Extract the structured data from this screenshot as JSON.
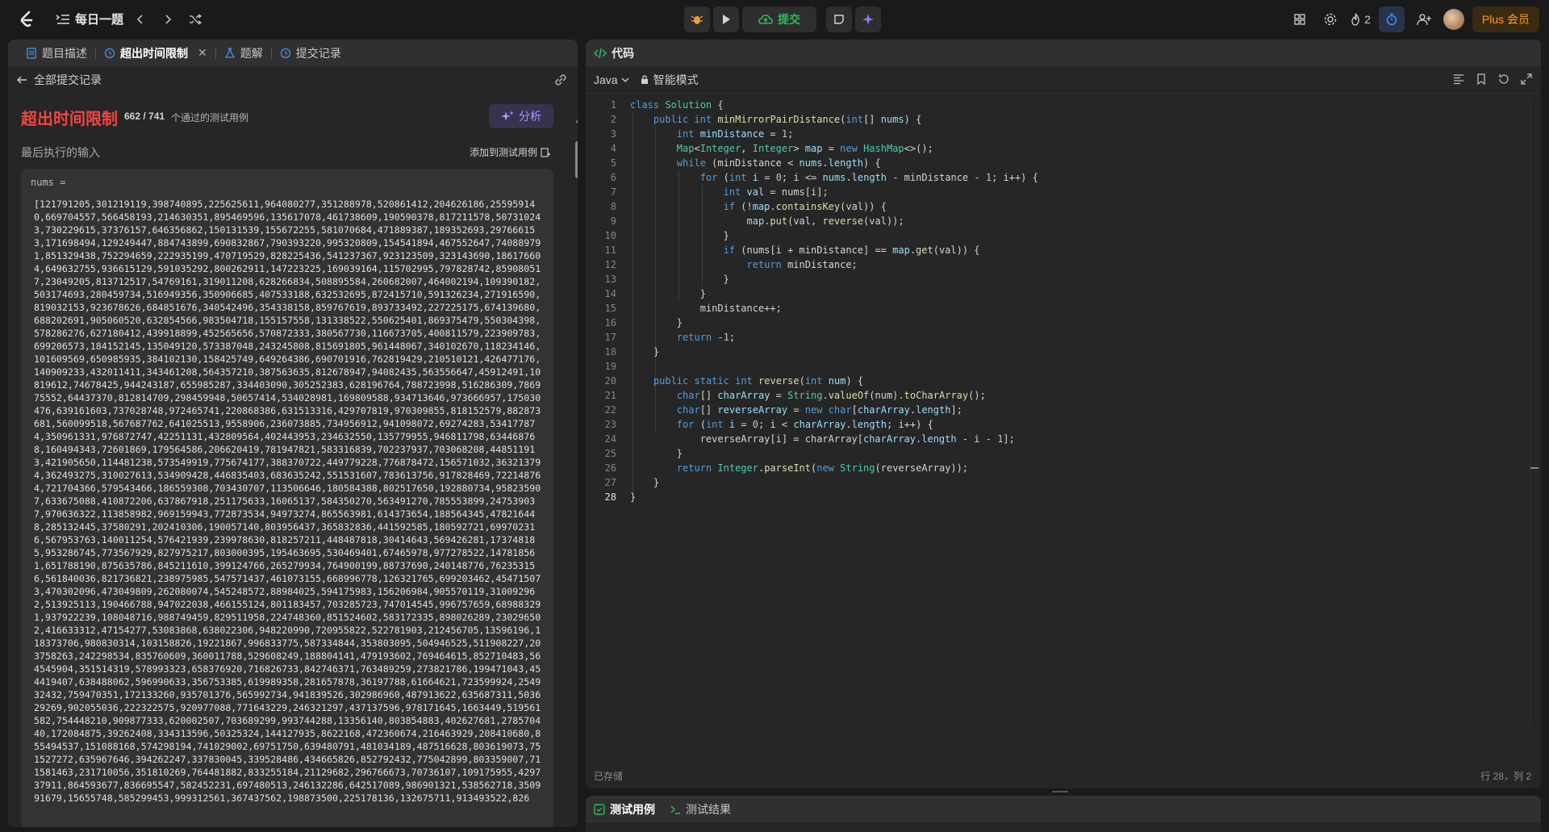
{
  "topbar": {
    "title": "每日一题",
    "submit_label": "提交",
    "streak_count": "2",
    "plus_label": "Plus 会员"
  },
  "left": {
    "tabs": [
      {
        "label": "题目描述"
      },
      {
        "label": "超出时间限制"
      },
      {
        "label": "题解"
      },
      {
        "label": "提交记录"
      }
    ],
    "back_label": "全部提交记录",
    "status": "超出时间限制",
    "count": "662 / 741",
    "count_suffix": "个通过的测试用例",
    "analyze_label": "分析",
    "last_input_label": "最后执行的输入",
    "add_testcase_label": "添加到测试用例",
    "input_key": "nums =",
    "input_value": "[121791205,301219119,398740895,225625611,964080277,351288978,520861412,204626186,255959140,669704557,566458193,214630351,895469596,135617078,461738609,190590378,817211578,507310243,730229615,37376157,646356862,150131539,155672255,581070684,471889387,189352693,297666153,171698494,129249447,884743899,690832867,790393220,995320809,154541894,467552647,740889791,851329438,752294659,222935199,470719529,828225436,541237367,923123509,323143690,186176604,649632755,936615129,591035292,800262911,147223225,169039164,115702995,797828742,859080517,23049205,813712517,54769161,319011208,628266834,508895584,260682007,464002194,109390182,503174693,280459734,516949356,350906685,407533188,632532695,872415710,591326234,271916590,819032153,923678626,684851676,340542496,354338158,859767619,893733492,227225175,674139680,688202691,905060520,632854566,983504718,155157558,131338522,550625401,869375479,550304398,578286276,627180412,439918899,452565656,570872333,380567730,116673705,400811579,223909783,699206573,184152145,135049120,573387048,243245808,815691805,961448067,340102670,118234146,101609569,650985935,384102130,158425749,649264386,690701916,762819429,210510121,426477176,140909233,432011411,343461208,564357210,387563635,812678947,94082435,563556647,45912491,10819612,74678425,944243187,655985287,334403090,305252383,628196764,788723998,516286309,786975552,64437370,812814709,298459948,50657414,534028981,169809588,934713646,973666957,175030476,639161603,737028748,972465741,220868386,631513316,429707819,970309855,818152579,882873681,560099518,567687762,641025513,9558906,236073885,734956912,941098072,69274283,534177874,350961331,976872747,42251131,432809564,402443953,234632550,135779955,946811798,634468768,160494343,72601869,179564586,206620419,781947821,583316839,702237937,703068208,448511913,421905650,114481238,573549919,775674177,388370722,449779228,776878472,156571032,363213794,362493275,310027613,534909428,446835403,683635242,551531607,783613756,917828469,722148764,721704366,579543466,186559308,703430707,113506646,180584388,802517650,192880734,958235907,633675088,410872206,637867918,251175633,16065137,584350270,563491270,785553899,247539037,970636322,113858982,969159943,772873534,94973274,865563981,614373654,188564345,478216448,285132445,37580291,202410306,190057140,803956437,365832836,441592585,180592721,699702316,567953763,140011254,576421939,239978630,818257211,448487818,30414643,569426281,173748185,953286745,773567929,827975217,803000395,195463695,530469401,67465978,977278522,147818561,651788190,875635786,845211610,399124766,265279934,764900199,88737690,240148776,762353156,561840036,821736821,238975985,547571437,461073155,668996778,126321765,699203462,454715073,470302096,473049809,262080074,545248572,88984025,594175983,156206984,905570119,310092962,513925113,190466788,947022038,466155124,801183457,703285723,747014545,996757659,689883291,937922239,108048716,988749459,829511958,224748360,851524602,583172335,898026289,230296502,416633312,47154277,53083868,638022306,948220990,720955822,522781903,212456705,13596196,118373706,980830314,103158826,19221867,996833775,587334844,353803095,504946525,511908227,203758263,242298534,835760609,360011788,529608249,188804141,479193602,769464615,852710483,564545904,351514319,578993323,658376920,716826733,842746371,763489259,273821786,199471043,454419407,638488062,596990633,356753385,619989358,281657878,36197788,61664621,723599924,254932432,759470351,172133260,935701376,565992734,941839526,302986960,487913622,635687311,503629269,902055036,222322575,920977088,771643229,246321297,437137596,978171645,1663449,519561582,754448210,909877333,620002507,703689299,993744288,13356140,803854883,402627681,278570440,172084875,39262408,334313596,50325324,144127935,8622168,472360674,216463929,208410680,855494537,151088168,574298194,741029002,69751750,639480791,481034189,487516628,803619073,751527272,635967646,394262247,337830045,339528486,434665826,852792432,775042899,803359007,711581463,231710056,351810269,764481882,833255184,21129682,296766673,70736107,109175955,429737911,864593677,836695547,582452231,697480513,246132286,642517089,986901321,538562718,350991679,15655748,585299453,999312561,367437562,198873500,225178136,132675711,913493522,826"
  },
  "editor": {
    "header_label": "代码",
    "language": "Java",
    "mode_label": "智能模式",
    "saved_label": "已存储",
    "cursor_position": "行 28，列 2"
  },
  "bottom": {
    "tabs": [
      {
        "label": "测试用例"
      },
      {
        "label": "测试结果"
      }
    ]
  },
  "colors": {
    "accent_orange": "#ffa116",
    "success_green": "#2cbb5d",
    "error_red": "#ef4743",
    "analyze_purple": "#a99bff"
  }
}
